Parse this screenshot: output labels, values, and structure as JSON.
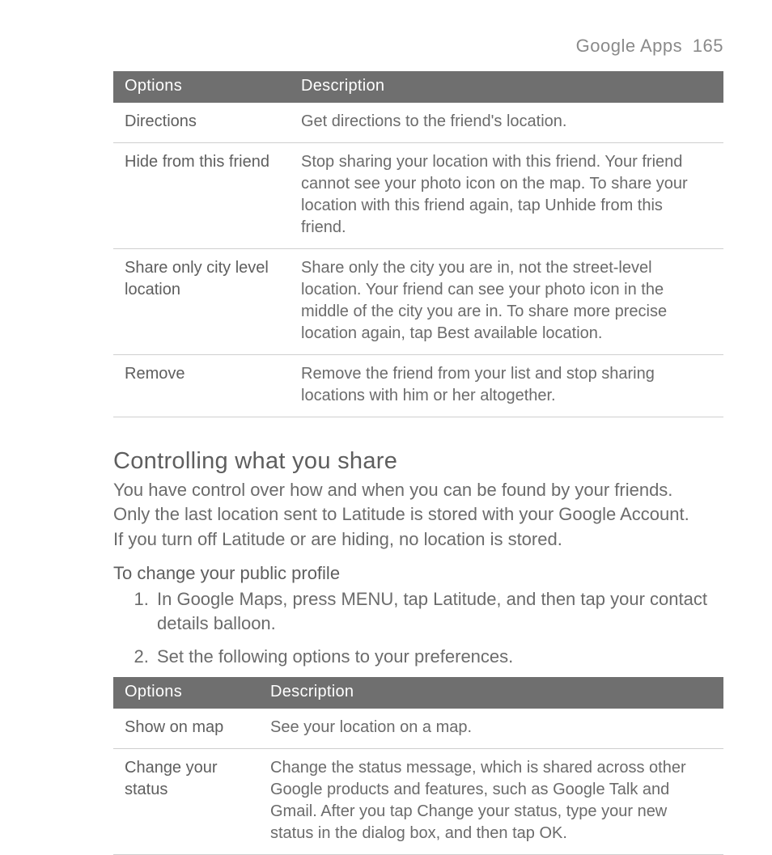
{
  "header": {
    "section": "Google Apps",
    "page_number": "165"
  },
  "table1": {
    "headers": {
      "c1": "Options",
      "c2": "Description"
    },
    "rows": [
      {
        "option": "Directions",
        "desc": "Get directions to the friend's location."
      },
      {
        "option": "Hide from this friend",
        "desc": "Stop sharing your location with this friend. Your friend cannot see your photo icon on the map. To share your location with this friend again, tap Unhide from this friend."
      },
      {
        "option": "Share only city level location",
        "desc": "Share only the city you are in, not the street-level location. Your friend can see your photo icon in the middle of the city you are in. To share more precise location again, tap Best available location."
      },
      {
        "option": "Remove",
        "desc": "Remove the friend from your list and stop sharing locations with him or her altogether."
      }
    ]
  },
  "section_heading": "Controlling what you share",
  "section_body": "You have control over how and when you can be found by your friends. Only the last location sent to Latitude is stored with your Google Account. If you turn off Latitude or are hiding, no location is stored.",
  "sub_heading": "To change your public profile",
  "steps": [
    "In Google Maps, press MENU, tap Latitude, and then tap your contact details balloon.",
    "Set the following options to your preferences."
  ],
  "table2": {
    "headers": {
      "c1": "Options",
      "c2": "Description"
    },
    "rows": [
      {
        "option": "Show on map",
        "desc": "See your location on a map."
      },
      {
        "option": "Change your status",
        "desc": "Change the status message, which is shared across other Google products and features, such as Google Talk and Gmail. After you tap Change your status, type your new status in the dialog box, and then tap OK."
      }
    ]
  }
}
